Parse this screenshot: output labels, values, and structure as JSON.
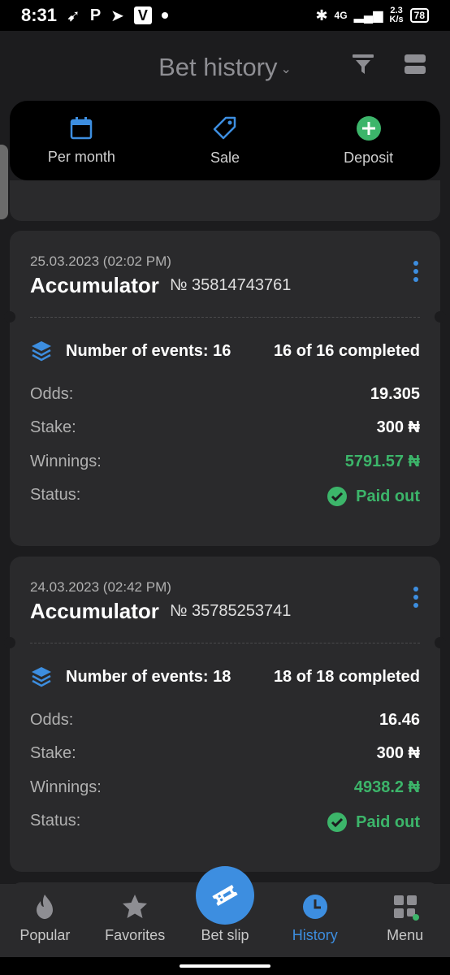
{
  "status_bar": {
    "time": "8:31",
    "network_glyph": "4G",
    "speed_value": "2.3",
    "speed_unit": "K/s",
    "battery": "78"
  },
  "header": {
    "title": "Bet history",
    "icons": [
      "filter-icon",
      "layout-icon"
    ]
  },
  "quick_actions": [
    {
      "label": "Per month",
      "icon": "calendar-icon",
      "color": "#3d8ee0"
    },
    {
      "label": "Sale",
      "icon": "tag-icon",
      "color": "#3d8ee0"
    },
    {
      "label": "Deposit",
      "icon": "plus-circle-icon",
      "color": "#3cb56a"
    }
  ],
  "bets": [
    {
      "date": "25.03.2023 (02:02 PM)",
      "type": "Accumulator",
      "number": "№ 35814743761",
      "events_label": "Number of events: 16",
      "completed": "16 of 16 completed",
      "odds_label": "Odds:",
      "odds": "19.305",
      "stake_label": "Stake:",
      "stake": "300 ₦",
      "winnings_label": "Winnings:",
      "winnings": "5791.57 ₦",
      "status_label": "Status:",
      "status": "Paid out"
    },
    {
      "date": "24.03.2023 (02:42 PM)",
      "type": "Accumulator",
      "number": "№ 35785253741",
      "events_label": "Number of events: 18",
      "completed": "18 of 18 completed",
      "odds_label": "Odds:",
      "odds": "16.46",
      "stake_label": "Stake:",
      "stake": "300 ₦",
      "winnings_label": "Winnings:",
      "winnings": "4938.2 ₦",
      "status_label": "Status:",
      "status": "Paid out"
    }
  ],
  "bottom_nav": [
    {
      "label": "Popular",
      "icon": "fire-icon",
      "active": false
    },
    {
      "label": "Favorites",
      "icon": "star-icon",
      "active": false
    },
    {
      "label": "Bet slip",
      "icon": "ticket-icon",
      "active": false
    },
    {
      "label": "History",
      "icon": "clock-icon",
      "active": true
    },
    {
      "label": "Menu",
      "icon": "menu-grid-icon",
      "active": false
    }
  ],
  "colors": {
    "accent": "#3d8ee0",
    "success": "#3cb56a",
    "background": "#1c1c1e",
    "card": "#2a2a2c"
  }
}
